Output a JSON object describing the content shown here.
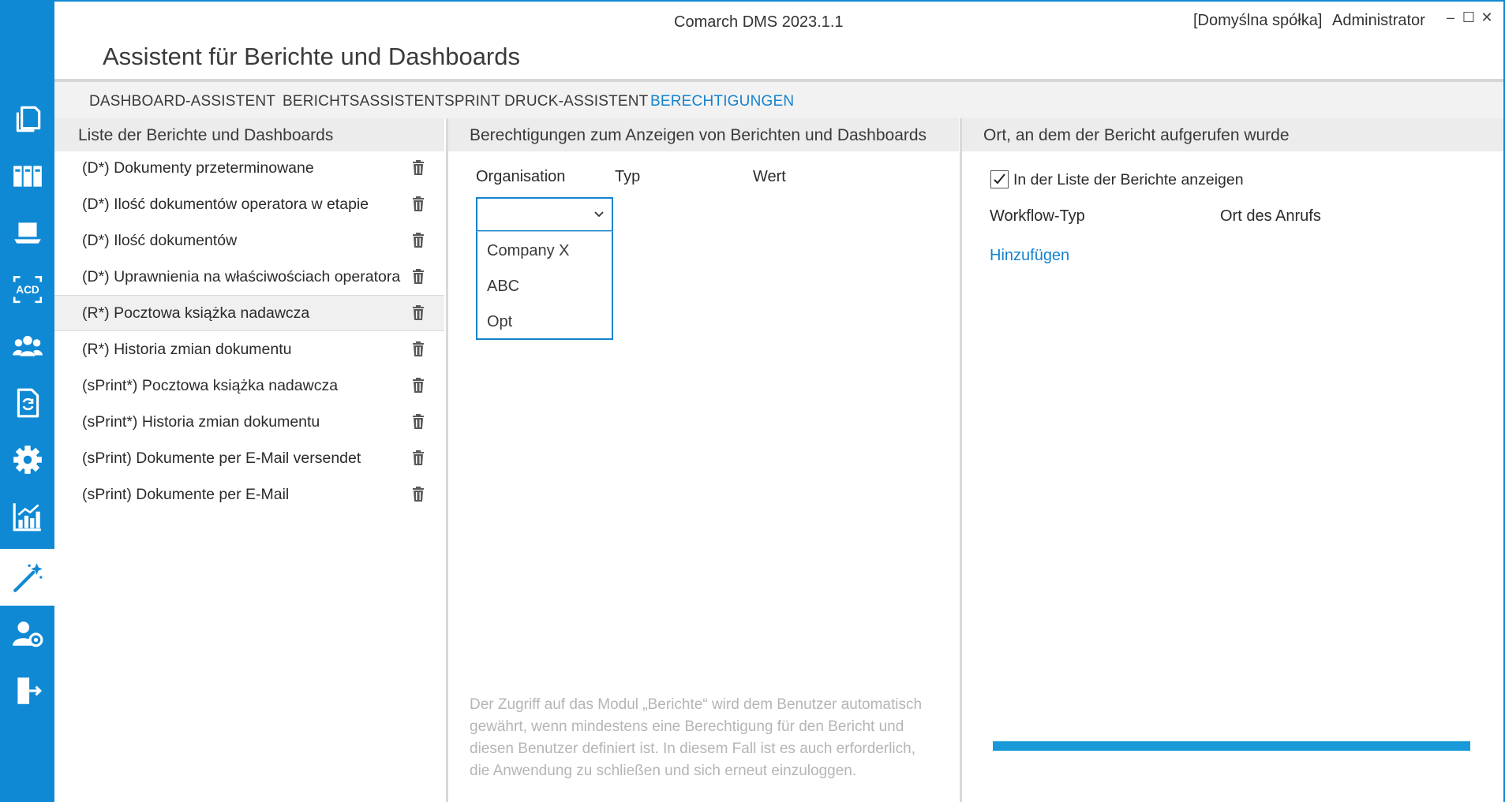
{
  "window": {
    "app_title": "Comarch DMS 2023.1.1",
    "company": "[Domyślna spółka]",
    "user": "Administrator",
    "controls": {
      "minimize": "–",
      "maximize": "☐",
      "close": "✕"
    }
  },
  "page_title": "Assistent für Berichte und Dashboards",
  "sidebar": {
    "items": [
      {
        "icon": "documents-icon",
        "active": false
      },
      {
        "icon": "binders-icon",
        "active": false
      },
      {
        "icon": "laptop-icon",
        "active": false
      },
      {
        "icon": "acd-icon",
        "label": "ACD",
        "active": false
      },
      {
        "icon": "users-icon",
        "active": false
      },
      {
        "icon": "document-sync-icon",
        "active": false
      },
      {
        "icon": "gear-icon",
        "active": false
      },
      {
        "icon": "chart-icon",
        "active": false
      },
      {
        "icon": "magic-wand-icon",
        "active": true
      },
      {
        "icon": "user-settings-icon",
        "active": false
      },
      {
        "icon": "exit-door-icon",
        "active": false
      }
    ]
  },
  "tabs": [
    {
      "label": "DASHBOARD-ASSISTENT",
      "active": false
    },
    {
      "label": "BERICHTSASSISTENT",
      "active": false
    },
    {
      "label": "SPRINT DRUCK-ASSISTENT",
      "active": false
    },
    {
      "label": "BERECHTIGUNGEN",
      "active": true
    }
  ],
  "reports_panel": {
    "title": "Liste der Berichte und Dashboards",
    "items": [
      {
        "label": "(D*) Dokumenty przeterminowane",
        "selected": false
      },
      {
        "label": "(D*) Ilość dokumentów operatora w etapie",
        "selected": false
      },
      {
        "label": "(D*) Ilość dokumentów",
        "selected": false
      },
      {
        "label": "(D*) Uprawnienia na właściwościach operatora",
        "selected": false
      },
      {
        "label": "(R*) Pocztowa książka nadawcza",
        "selected": true
      },
      {
        "label": "(R*) Historia zmian dokumentu",
        "selected": false
      },
      {
        "label": "(sPrint*) Pocztowa książka nadawcza",
        "selected": false
      },
      {
        "label": "(sPrint*) Historia zmian dokumentu",
        "selected": false
      },
      {
        "label": "(sPrint) Dokumente per E-Mail versendet",
        "selected": false
      },
      {
        "label": "(sPrint) Dokumente per E-Mail",
        "selected": false
      }
    ]
  },
  "permissions_panel": {
    "title": "Berechtigungen zum Anzeigen von Berichten und Dashboards",
    "columns": {
      "organisation": "Organisation",
      "type": "Typ",
      "value": "Wert"
    },
    "organisation_select": {
      "value": "",
      "options": [
        "Company X",
        "ABC",
        "Opt"
      ]
    },
    "note": "Der Zugriff auf das Modul „Berichte“ wird dem Benutzer automatisch gewährt, wenn mindestens eine Berechtigung für den Bericht und diesen Benutzer definiert ist. In diesem Fall ist es auch erforderlich, die Anwendung zu schließen und sich erneut einzuloggen."
  },
  "location_panel": {
    "title": "Ort, an dem der Bericht aufgerufen wurde",
    "show_in_list": {
      "label": "In der Liste der Berichte anzeigen",
      "checked": true
    },
    "columns": {
      "workflow_type": "Workflow-Typ",
      "call_location": "Ort des Anrufs"
    },
    "add_link": "Hinzufügen"
  },
  "progress": {
    "value": 1.0
  },
  "colors": {
    "accent": "#1089d4",
    "link": "#1583cf",
    "progress": "#199ad8"
  }
}
